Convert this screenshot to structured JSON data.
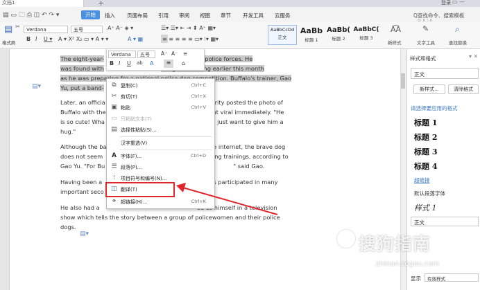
{
  "titlebar": {
    "doc_tab": "文档1",
    "new_tab": "+",
    "login": "登录",
    "win_icons": "▭ —"
  },
  "menu": {
    "start": "开始",
    "items": [
      "插入",
      "页面布局",
      "引用",
      "审阅",
      "视图",
      "章节",
      "开发工具",
      "云服务"
    ],
    "search": "Q查找命令、搜索模板",
    "right_tools": "⊙ ∧ ⁝ ∧"
  },
  "ribbon": {
    "paste_label": "格式刷",
    "font_name": "Verdana",
    "font_size": "五号",
    "styles": [
      {
        "preview": "AaBbCcDd",
        "name": "正文"
      },
      {
        "preview": "AaBb",
        "name": "标题 1"
      },
      {
        "preview": "AaBb(",
        "name": "标题 2"
      },
      {
        "preview": "AaBbC(",
        "name": "标题 3"
      }
    ],
    "new_style": "新样式",
    "text_tool": "文字工具",
    "find_replace": "查找替换"
  },
  "document": {
    "para1": [
      "The eight-year-",
      "the Beijing police forces. He",
      "was found with",
      "a regular training earlier this month",
      "as he was preparing for a national police dog competition. Buffalo's trainer, Gao",
      "Yu, put a band-"
    ],
    "para2": [
      "Later, an officia",
      "curity posted the photo of",
      "Buffalo with the",
      "went viral immediately. \"He",
      "is so cute! Wha",
      ", \"I just want to give him a",
      "hug.\""
    ],
    "para3": [
      "Although the ba",
      "the internet, the brave dog",
      "does not seem",
      "uring trainings, according to",
      "Gao Yu. \"For Bu",
      "\" said Gao."
    ],
    "para4": [
      "Having been a",
      "as participated in many",
      "important seco"
    ],
    "para5": [
      "He also had a",
      "ed as himself in a television",
      "show which tells the story between a group of policewomen and their police",
      "dogs."
    ]
  },
  "mini_toolbar": {
    "font": "Verdana",
    "size": "五号",
    "buttons": [
      "A⁺",
      "A⁻",
      "≡"
    ],
    "buttons2": [
      "B",
      "I",
      "U",
      "ab",
      "A",
      "≡",
      "⌂"
    ]
  },
  "context_menu": {
    "items": [
      {
        "label": "复制(C)",
        "shortcut": "Ctrl+C",
        "icon": "copy-icon"
      },
      {
        "label": "剪切(T)",
        "shortcut": "Ctrl+X",
        "icon": "cut-icon"
      },
      {
        "label": "粘贴",
        "shortcut": "Ctrl+V",
        "icon": "paste-icon"
      },
      {
        "label": "只粘贴文本(T)",
        "shortcut": "",
        "icon": "paste-text-icon"
      },
      {
        "label": "选择性粘贴(S)...",
        "shortcut": "",
        "icon": "paste-special-icon"
      },
      {
        "label": "汉字重选(V)",
        "shortcut": "",
        "icon": ""
      },
      {
        "label": "字体(F)...",
        "shortcut": "Ctrl+D",
        "icon": "font-icon"
      },
      {
        "label": "段落(P)...",
        "shortcut": "",
        "icon": "paragraph-icon"
      },
      {
        "label": "项目符号和编号(N)...",
        "shortcut": "",
        "icon": "bullets-icon"
      },
      {
        "label": "翻译(T)",
        "shortcut": "",
        "icon": "translate-icon"
      },
      {
        "label": "超链接(H)...",
        "shortcut": "Ctrl+K",
        "icon": "hyperlink-icon"
      }
    ]
  },
  "pane": {
    "title": "样式和格式",
    "current_style": "正文",
    "new_style_btn": "新样式...",
    "clear_btn": "清除格式",
    "apply_label": "请选择要应用的格式",
    "headings": [
      "标题 1",
      "标题 2",
      "标题 3",
      "标题 4"
    ],
    "link": "超链接",
    "default_font": "默认段落字体",
    "style1": "样式 1",
    "body": "正文",
    "show_label": "显示",
    "show_value": "有效样式"
  },
  "watermark": {
    "text": "搜狗指南",
    "url": "zhinan.sogou.com"
  },
  "colors": {
    "accent": "#4a90e2",
    "highlight_box": "#e0262c",
    "arrow": "#e0262c"
  }
}
